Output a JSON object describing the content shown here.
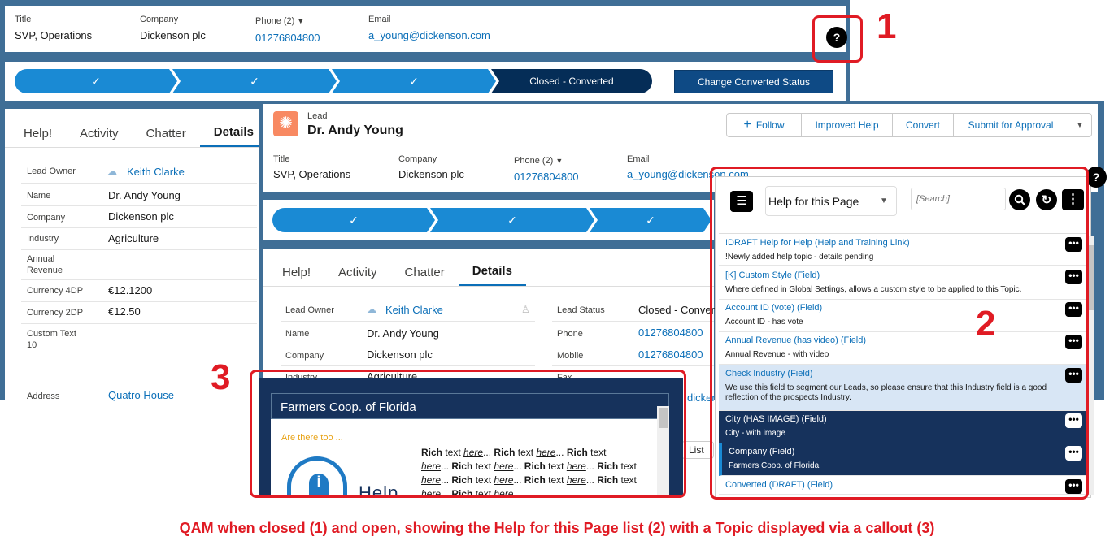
{
  "header1": {
    "title_label": "Title",
    "title_value": "SVP, Operations",
    "company_label": "Company",
    "company_value": "Dickenson plc",
    "phone_label": "Phone (2)",
    "phone_value": "01276804800",
    "email_label": "Email",
    "email_value": "a_young@dickenson.com"
  },
  "path1": {
    "check": "✓",
    "closed": "Closed - Converted",
    "change_btn": "Change Converted Status"
  },
  "tabs1": [
    "Help!",
    "Activity",
    "Chatter",
    "Details"
  ],
  "details1": [
    {
      "label": "Lead Owner",
      "value": "Keith Clarke"
    },
    {
      "label": "Name",
      "value": "Dr. Andy Young"
    },
    {
      "label": "Company",
      "value": "Dickenson plc"
    },
    {
      "label": "Industry",
      "value": "Agriculture"
    },
    {
      "label": "Annual Revenue",
      "value": ""
    },
    {
      "label": "Currency 4DP",
      "value": "€12.1200"
    },
    {
      "label": "Currency 2DP",
      "value": "€12.50"
    },
    {
      "label": "Custom Text 10",
      "value": ""
    },
    {
      "label": "Address",
      "value": "Quatro House"
    }
  ],
  "lead": {
    "object": "Lead",
    "name": "Dr. Andy Young",
    "actions": {
      "follow": "Follow",
      "improved_help": "Improved Help",
      "convert": "Convert",
      "submit": "Submit for Approval"
    },
    "title_label": "Title",
    "title_value": "SVP, Operations",
    "company_label": "Company",
    "company_value": "Dickenson plc",
    "phone_label": "Phone (2)",
    "phone_value": "01276804800",
    "email_label": "Email",
    "email_value": "a_young@dickenson.com"
  },
  "tabs2": [
    "Help!",
    "Activity",
    "Chatter",
    "Details"
  ],
  "details2": {
    "left": [
      {
        "label": "Lead Owner",
        "value": "Keith Clarke"
      },
      {
        "label": "Name",
        "value": "Dr. Andy Young"
      },
      {
        "label": "Company",
        "value": "Dickenson plc"
      },
      {
        "label": "Industry",
        "value": "Agriculture"
      }
    ],
    "right": [
      {
        "label": "Lead Status",
        "value": "Closed - Convert"
      },
      {
        "label": "Phone",
        "value": "01276804800"
      },
      {
        "label": "Mobile",
        "value": "01276804800"
      },
      {
        "label": "Fax",
        "value": ""
      }
    ],
    "email_fragment": "dicker",
    "list_fragment": "List"
  },
  "qam": {
    "dropdown": "Help for this Page",
    "search_placeholder": "[Search]",
    "items": [
      {
        "title": "!DRAFT Help for Help (Help and Training Link)",
        "desc": "!Newly added help topic - details pending",
        "style": "normal"
      },
      {
        "title": "[K] Custom Style (Field)",
        "desc": "Where defined in Global Settings, allows a custom style to be applied to this Topic.",
        "style": "normal"
      },
      {
        "title": "Account ID (vote) (Field)",
        "desc": "Account ID - has vote",
        "style": "normal"
      },
      {
        "title": "Annual Revenue (has video) (Field)",
        "desc": "Annual Revenue - with video",
        "style": "normal"
      },
      {
        "title": "Check Industry (Field)",
        "desc": "We use this field to segment our Leads, so please ensure that this Industry field is a good reflection of the prospects Industry.",
        "style": "light"
      },
      {
        "title": "City (HAS IMAGE) (Field)",
        "desc": "City - with image",
        "style": "dark"
      },
      {
        "title": "Company (Field)",
        "desc": "Farmers Coop. of Florida",
        "style": "dark"
      },
      {
        "title": "Converted (DRAFT) (Field)",
        "desc": "",
        "style": "normal"
      }
    ]
  },
  "callout": {
    "title": "Farmers Coop. of Florida",
    "tagline": "Are there too ...",
    "text_lines": [
      "Rich text here... Rich text here... Rich text",
      "here... Rich text here... Rich text here... Rich text",
      "here... Rich text here... Rich text here... Rich text",
      "here... Rich text here..."
    ],
    "logo_text": "Help"
  },
  "annotations": {
    "n1": "1",
    "n2": "2",
    "n3": "3"
  },
  "caption": "QAM when closed (1) and open, showing the Help for this Page list (2) with a Topic displayed via a callout (3)",
  "icons": {
    "help": "?",
    "menu_dots": "⋮",
    "ellipsis": "•••"
  },
  "colors": {
    "accent_red": "#e01b24",
    "sf_blue": "#0b6fb8",
    "navy": "#16325c",
    "path_blue": "#1a8ad4"
  }
}
